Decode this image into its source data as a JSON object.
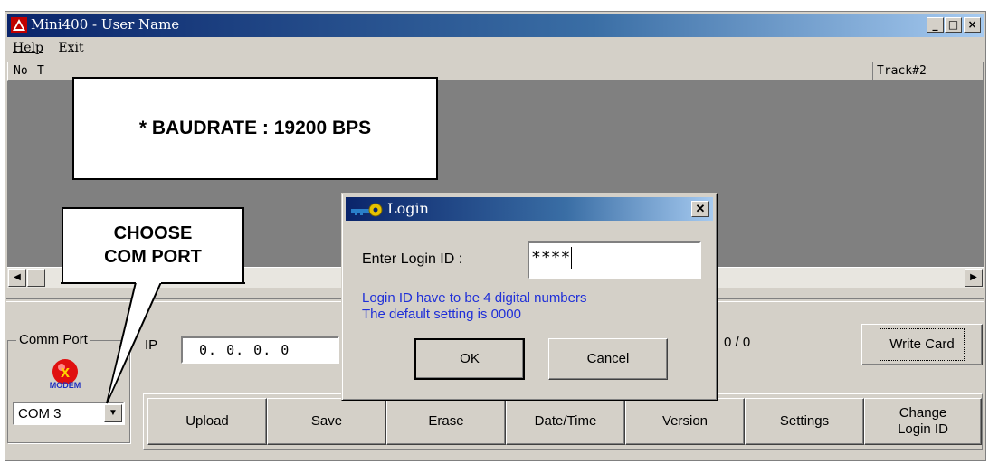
{
  "window": {
    "title": "Mini400  -  User Name",
    "controls": {
      "minimize": "_",
      "maximize": "□",
      "close": "×"
    }
  },
  "menu": {
    "items": [
      {
        "label": "Help"
      },
      {
        "label": "Exit"
      }
    ]
  },
  "list": {
    "columns": [
      {
        "label": "No"
      },
      {
        "label": "T"
      },
      {
        "label": "Track#2"
      }
    ]
  },
  "comm_port": {
    "group_label": "Comm Port",
    "icon_label": "MODEM",
    "selected": "COM 3"
  },
  "ip": {
    "label": "IP",
    "value": "0.  0.  0.  0"
  },
  "count_text": "0 / 0",
  "buttons": {
    "write_card": "Write Card",
    "upload": "Upload",
    "save": "Save",
    "erase": "Erase",
    "datetime": "Date/Time",
    "version": "Version",
    "settings": "Settings",
    "change_login_line1": "Change",
    "change_login_line2": "Login ID"
  },
  "callouts": {
    "baudrate": "* BAUDRATE : 19200 BPS",
    "choose_line1": "CHOOSE",
    "choose_line2": "COM PORT"
  },
  "login_dialog": {
    "title": "Login",
    "prompt": "Enter Login ID :",
    "value": "****",
    "info_line1": "Login ID have to be 4 digital numbers",
    "info_line2": "The default setting is 0000",
    "ok": "OK",
    "cancel": "Cancel"
  },
  "colors": {
    "title_bar": "#0a246a",
    "info_text": "#1f2fd8",
    "face": "#d4d0c8"
  },
  "icons": [
    "app-icon",
    "login-key-icon",
    "modem-icon",
    "scroll-left-arrow-icon",
    "scroll-right-arrow-icon",
    "dropdown-arrow-icon"
  ]
}
